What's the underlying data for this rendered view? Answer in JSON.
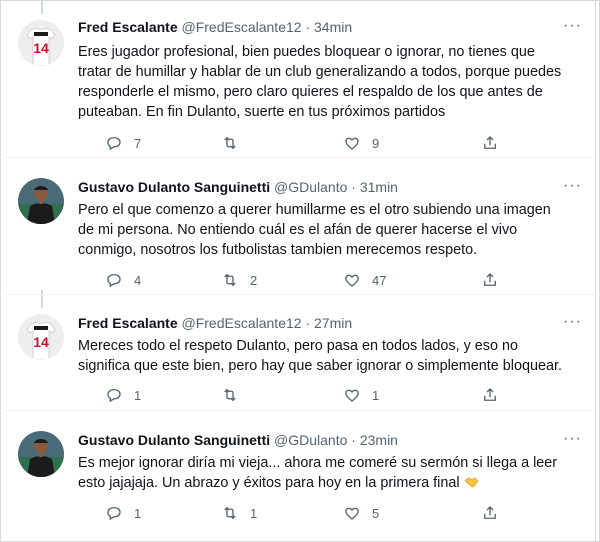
{
  "tweets": [
    {
      "name": "Fred Escalante",
      "handle": "@FredEscalante12",
      "dot": "·",
      "time": "34min",
      "lines": [
        "Eres jugador profesional, bien puedes bloquear o ignorar, no tienes que",
        "tratar de humillar y hablar de un club generalizando a todos, porque puedes",
        "responderle el mismo, pero claro quieres el respaldo de los que antes de",
        "puteaban. En fin Dulanto, suerte en tus próximos partidos"
      ],
      "replies": "7",
      "retweets": "",
      "likes": "9",
      "avatar": "jersey"
    },
    {
      "name": "Gustavo Dulanto Sanguinetti",
      "handle": "@GDulanto",
      "dot": "·",
      "time": "31min",
      "lines": [
        "Pero el que comenzo a querer humillarme es el otro subiendo una imagen",
        "de mi persona. No entiendo cuál es el afán de querer hacerse el vivo",
        "conmigo, nosotros los futbolistas tambien merecemos respeto."
      ],
      "replies": "4",
      "retweets": "2",
      "likes": "47",
      "avatar": "player"
    },
    {
      "name": "Fred Escalante",
      "handle": "@FredEscalante12",
      "dot": "·",
      "time": "27min",
      "lines": [
        "Mereces todo el respeto Dulanto, pero pasa en todos lados, y eso no",
        "significa que este bien, pero hay que saber ignorar o simplemente bloquear."
      ],
      "replies": "1",
      "retweets": "",
      "likes": "1",
      "avatar": "jersey"
    },
    {
      "name": "Gustavo Dulanto Sanguinetti",
      "handle": "@GDulanto",
      "dot": "·",
      "time": "23min",
      "lines": [
        "Es mejor ignorar diría mi vieja... ahora me comeré su sermón si llega a leer",
        "esto jajajaja. Un abrazo y éxitos para hoy en la primera final"
      ],
      "replies": "1",
      "retweets": "1",
      "likes": "5",
      "avatar": "player",
      "trailing_emoji": "handshake-emoji"
    }
  ],
  "icons": {
    "more": "more-icon",
    "reply": "reply-icon",
    "retweet": "retweet-icon",
    "like": "like-icon",
    "share": "share-icon"
  },
  "colors": {
    "text": "#0f1419",
    "secondary": "#536471",
    "thread_line": "#cfd9de",
    "jersey_red": "#c8102e"
  }
}
